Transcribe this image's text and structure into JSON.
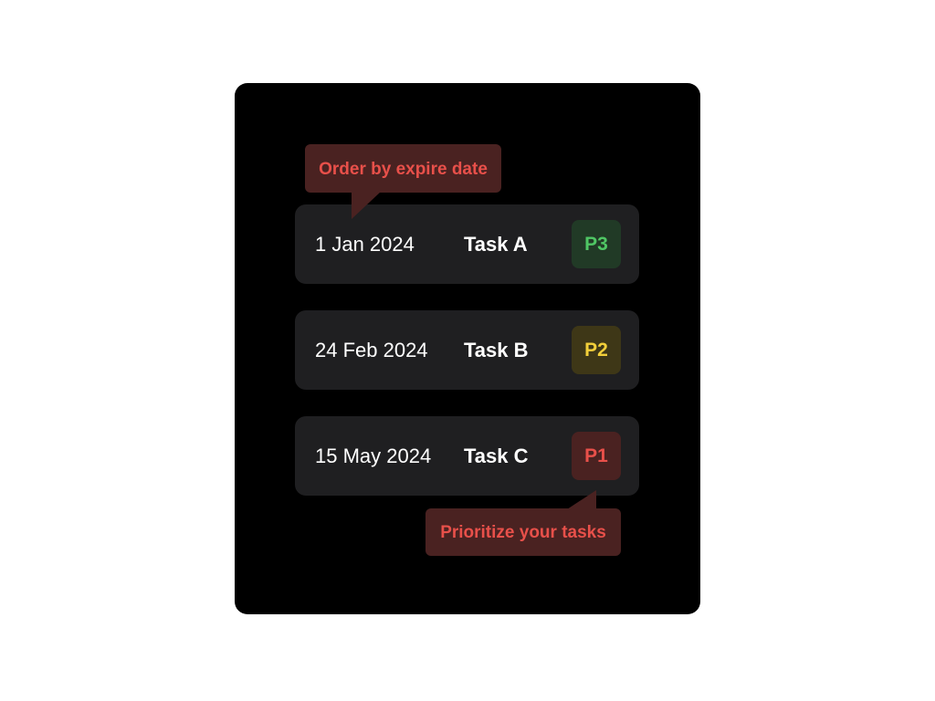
{
  "callouts": {
    "top": "Order by expire date",
    "bottom": "Prioritize your tasks"
  },
  "tasks": [
    {
      "date": "1 Jan 2024",
      "name": "Task A",
      "priority": "P3"
    },
    {
      "date": "24 Feb 2024",
      "name": "Task B",
      "priority": "P2"
    },
    {
      "date": "15 May 2024",
      "name": "Task C",
      "priority": "P1"
    }
  ],
  "colors": {
    "panel_bg": "#000000",
    "row_bg": "#1f1f21",
    "p3_text": "#4fc664",
    "p2_text": "#f2cf3a",
    "p1_text": "#e8504a",
    "callout_bg": "#4a2221",
    "callout_text": "#e8504a"
  }
}
